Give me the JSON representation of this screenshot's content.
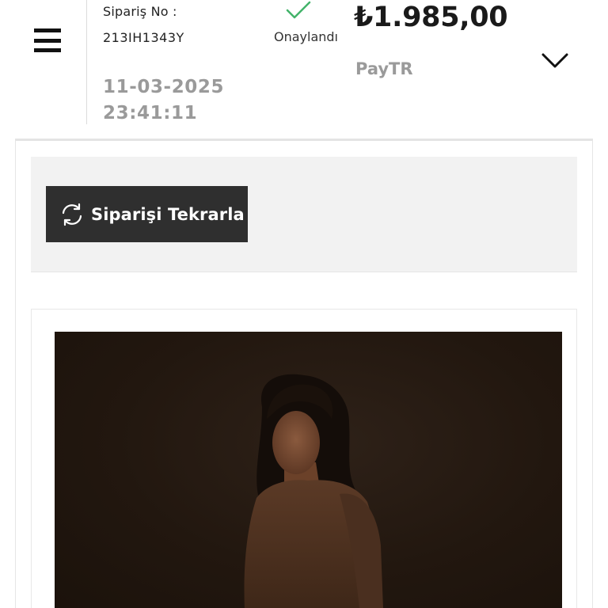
{
  "order": {
    "number_label": "Sipariş No :",
    "number": "213IH1343Y",
    "date": "11-03-2025",
    "time": "23:41:11",
    "status": "Onaylandı",
    "price": "₺1.985,00",
    "payment_method": "PayTR"
  },
  "actions": {
    "reorder_label": "Siparişi Tekrarla"
  },
  "icons": {
    "menu": "hamburger-menu-icon",
    "status": "check-icon",
    "expand": "chevron-down-icon",
    "reorder": "refresh-icon"
  },
  "colors": {
    "status_check": "#43b36a",
    "button_bg": "#2f2f2f",
    "panel_bg": "#f2f2f2",
    "muted_text": "#9a9a9a"
  }
}
